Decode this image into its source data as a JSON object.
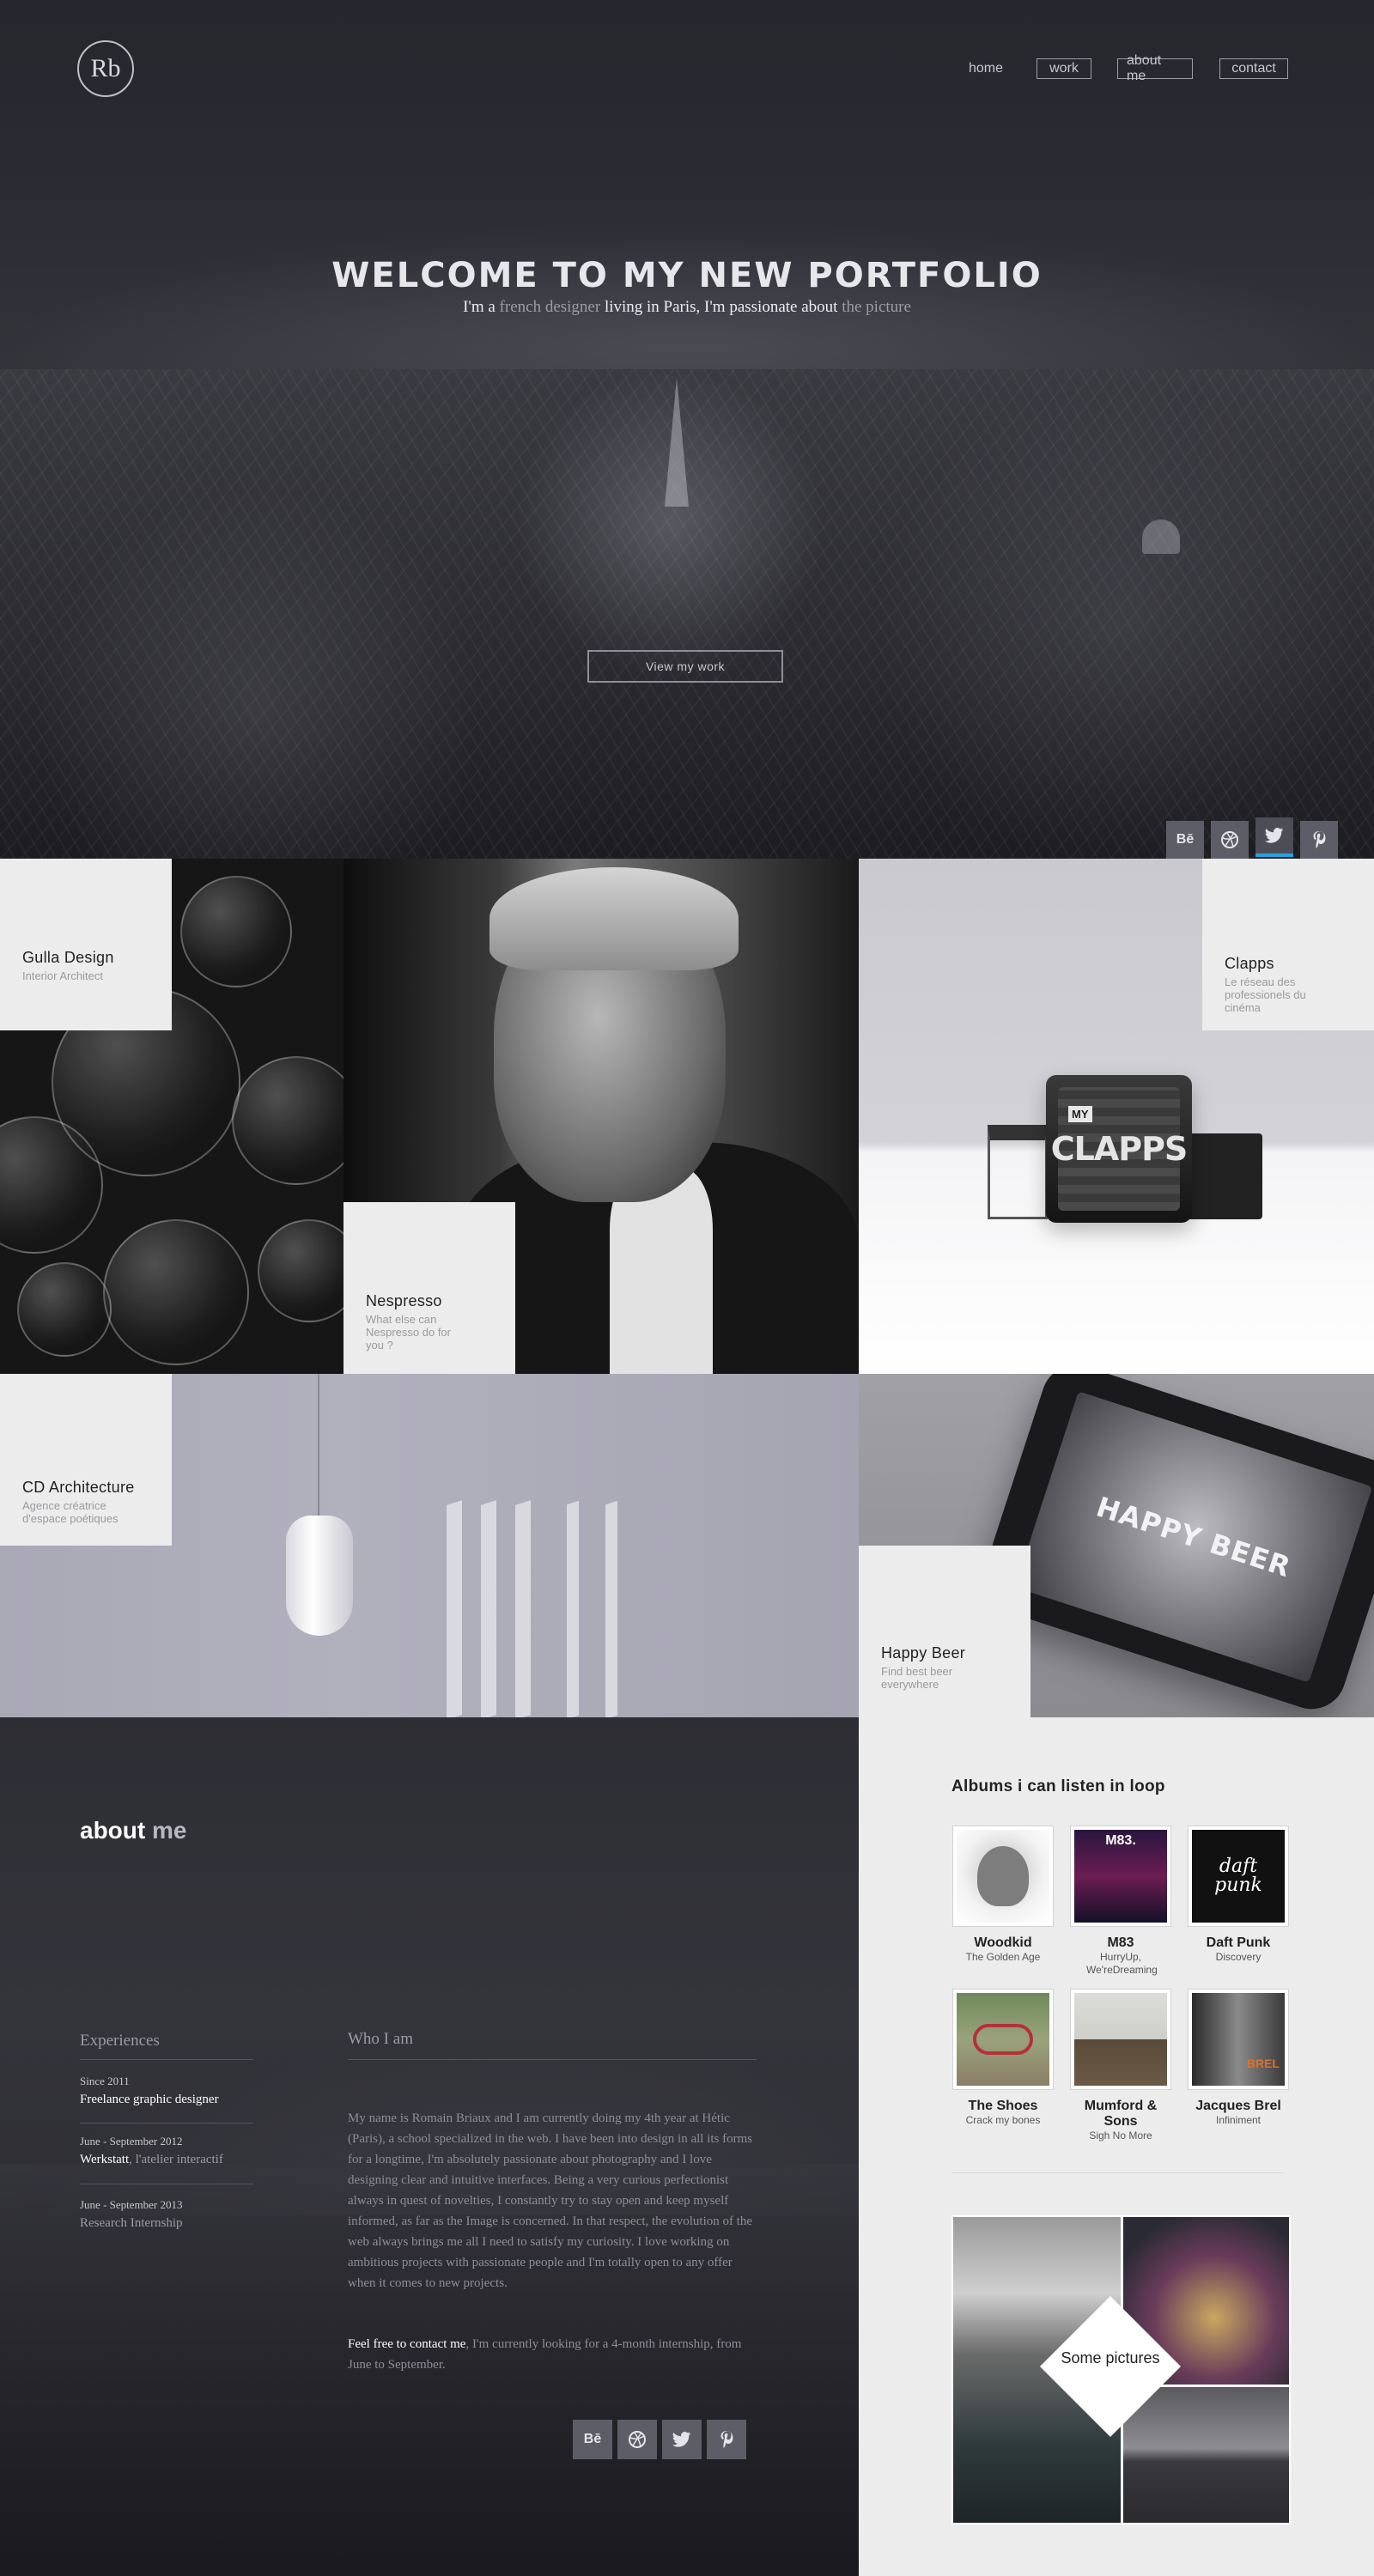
{
  "header": {
    "logo": "Rb",
    "nav": [
      "home",
      "work",
      "about me",
      "contact"
    ]
  },
  "hero": {
    "title": "WELCOME TO MY NEW PORTFOLIO",
    "subtitle_a": "I'm a ",
    "subtitle_b": "french designer",
    "subtitle_c": " living in Paris, I'm passionate about ",
    "subtitle_d": "the picture",
    "cta": "View my work"
  },
  "social": {
    "behance": "Bē",
    "dribbble": "◎",
    "twitter": "🐦",
    "pinterest": "𝓅"
  },
  "projects": [
    {
      "title": "Gulla Design",
      "subtitle": "Interior Architect"
    },
    {
      "title": "Nespresso",
      "subtitle": "What else can Nespresso do for you ?"
    },
    {
      "title": "Clapps",
      "subtitle": "Le réseau des professionels du cinéma"
    },
    {
      "title": "CD Architecture",
      "subtitle": "Agence créatrice d'espace poétiques"
    },
    {
      "title": "Happy Beer",
      "subtitle": "Find best beer everywhere"
    }
  ],
  "clapps_logo": "CLAPPS",
  "clapps_badge": "MY",
  "happy_beer_logo": "HAPPY BEER",
  "about": {
    "title_a": "about",
    "title_b": " me",
    "experiences_heading": "Experiences",
    "who_heading": "Who I am",
    "experiences": [
      {
        "date": "Since 2011",
        "role": "Freelance graphic designer",
        "role_extra": ""
      },
      {
        "date": "June - September 2012",
        "role": "Werkstatt",
        "role_extra": ", l'atelier interactif"
      },
      {
        "date": "June - September  2013",
        "role": "",
        "role_extra": "Research Internship"
      }
    ],
    "bio": "My name is Romain Briaux and I am currently doing my 4th year at Hétic (Paris), a school specialized in the web. I have been into design in all its forms for a longtime, I'm absolutely passionate about photography and I love designing clear and intuitive interfaces. Being a very curious perfectionist always in quest of novelties, I constantly try to stay open and keep myself informed, as far as the Image is concerned. In that respect, the evolution of the web always brings me all I need to satisfy my curiosity. I love working on ambitious projects with passionate people and I'm totally open to any offer when it comes to new projects.",
    "contact_a": "Feel free to contact me",
    "contact_b": ", I'm currently looking for a 4-month internship, from June to September."
  },
  "albums": {
    "title": "Albums i can listen in loop",
    "items": [
      {
        "name": "Woodkid",
        "sub": "The Golden Age"
      },
      {
        "name": "M83",
        "sub": "HurryUp, We'reDreaming"
      },
      {
        "name": "Daft Punk",
        "sub": "Discovery"
      },
      {
        "name": "The Shoes",
        "sub": "Crack my bones"
      },
      {
        "name": "Mumford & Sons",
        "sub": "Sigh No More"
      },
      {
        "name": "Jacques Brel",
        "sub": "Infiniment"
      }
    ],
    "covers": {
      "m83": "M83.",
      "daft": "daft punk",
      "brel": "BREL"
    },
    "pictures_label": "Some pictures"
  },
  "colors": {
    "accent": "#27a3e0",
    "tile_label_bg": "#ececec",
    "social_bg": "#5d5d68"
  }
}
